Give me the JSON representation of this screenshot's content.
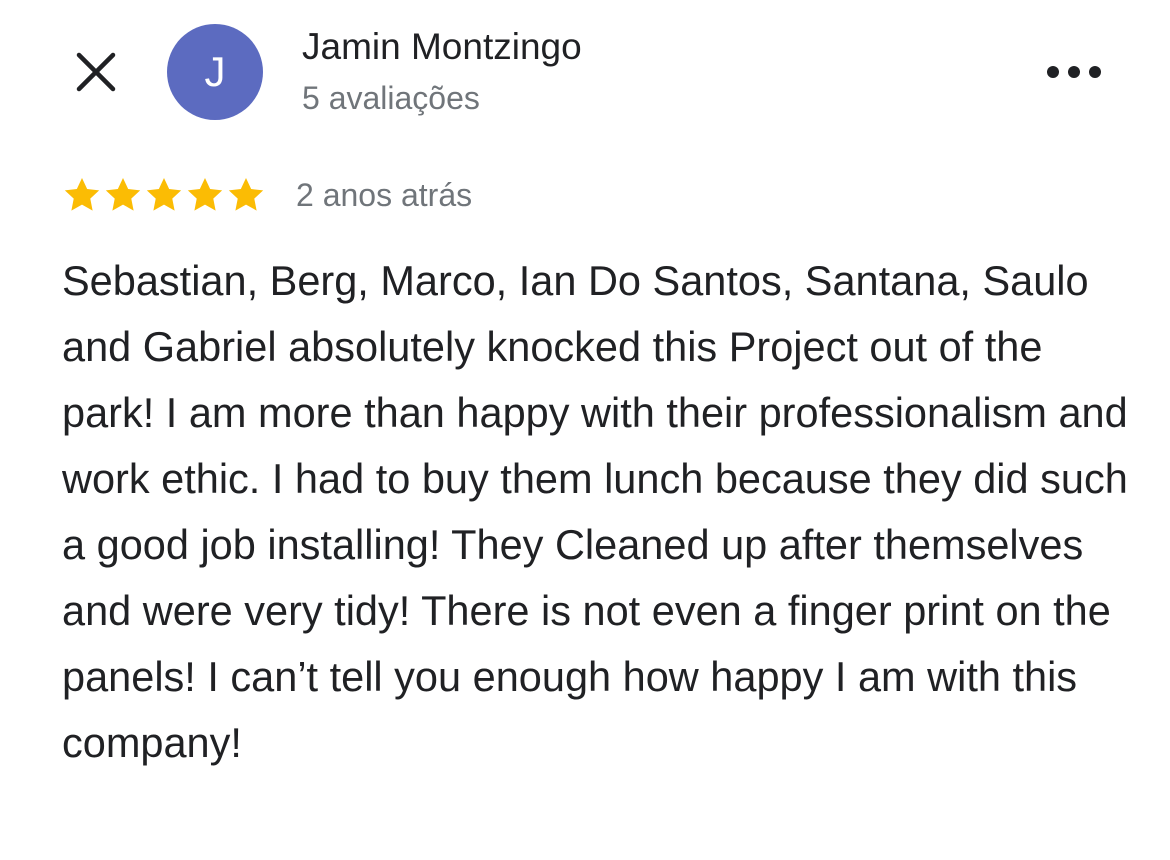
{
  "header": {
    "close_icon": "close-icon",
    "avatar_letter": "J",
    "avatar_color": "#5c6bc0",
    "reviewer_name": "Jamin Montzingo",
    "review_count": "5 avaliações",
    "more_icon": "more-horizontal-icon"
  },
  "review": {
    "rating": 5,
    "max_rating": 5,
    "star_color": "#fbbc04",
    "star_icon": "star-icon",
    "time": "2 anos atrás",
    "text": "Sebastian, Berg, Marco, Ian Do Santos, Santana, Saulo and Gabriel absolutely knocked this Project out of the park! I am more than happy with their professionalism and work ethic. I had to buy them lunch because they did such a good job installing! They Cleaned up after themselves and were very tidy! There is not even a finger print on the panels! I can’t tell you enough how happy I am with this company!"
  }
}
